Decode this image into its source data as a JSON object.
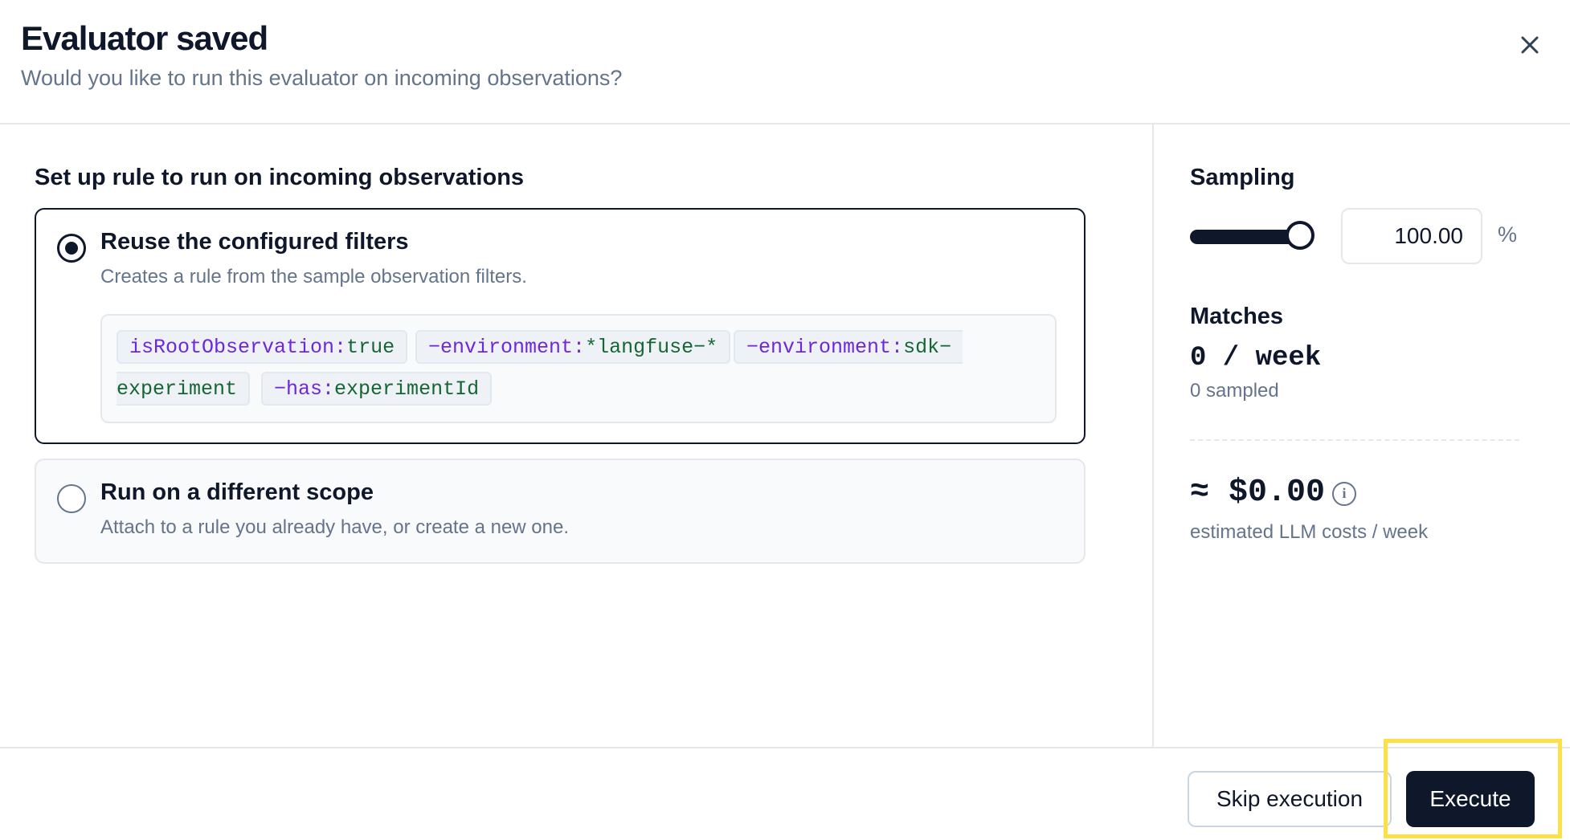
{
  "header": {
    "title": "Evaluator saved",
    "subtitle": "Would you like to run this evaluator on incoming observations?"
  },
  "main": {
    "section_title": "Set up rule to run on incoming observations",
    "options": [
      {
        "title": "Reuse the configured filters",
        "description": "Creates a rule from the sample observation filters.",
        "selected": true
      },
      {
        "title": "Run on a different scope",
        "description": "Attach to a rule you already have, or create a new one.",
        "selected": false
      }
    ],
    "filters": [
      {
        "prefix": "",
        "key": "isRootObservation",
        "sep": ":",
        "value": "true"
      },
      {
        "prefix": "−",
        "key": "environment",
        "sep": ":",
        "value": "*langfuse−*"
      },
      {
        "prefix": "−",
        "key": "environment",
        "sep": ":",
        "value": "sdk−"
      },
      {
        "prefix": "",
        "key": "",
        "sep": "",
        "value": "experiment"
      },
      {
        "prefix": "−",
        "key": "has",
        "sep": ":",
        "value": "experimentId"
      }
    ]
  },
  "sidebar": {
    "sampling_label": "Sampling",
    "sampling_value": "100.00",
    "sampling_unit": "%",
    "sampling_fraction": 1.0,
    "matches_label": "Matches",
    "matches_value": "0 / week",
    "matches_sampled": "0 sampled",
    "cost_value": "≈ $0.00",
    "cost_label": "estimated LLM costs / week",
    "info_icon": "info-icon"
  },
  "footer": {
    "skip_label": "Skip execution",
    "execute_label": "Execute"
  },
  "colors": {
    "primary": "#0f172a",
    "muted": "#64748b",
    "filter_key": "#6d28d9",
    "filter_value": "#166534",
    "highlight": "#fde047"
  }
}
